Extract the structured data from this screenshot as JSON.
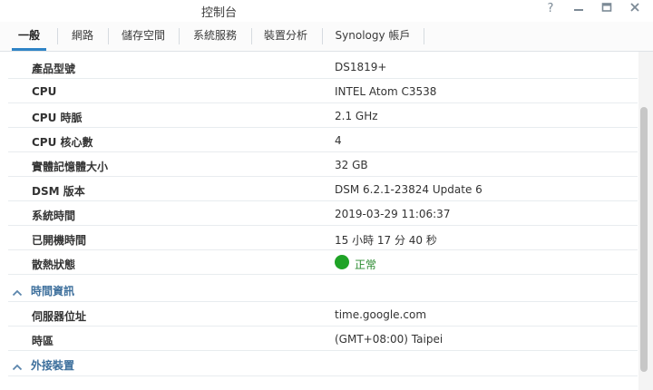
{
  "window": {
    "title": "控制台"
  },
  "tabs": [
    {
      "label": "一般"
    },
    {
      "label": "網路"
    },
    {
      "label": "儲存空間"
    },
    {
      "label": "系統服務"
    },
    {
      "label": "裝置分析"
    },
    {
      "label": "Synology 帳戶"
    }
  ],
  "rows": [
    {
      "label": "產品型號",
      "value": "DS1819+"
    },
    {
      "label": "CPU",
      "value": "INTEL Atom C3538"
    },
    {
      "label": "CPU 時脈",
      "value": "2.1 GHz"
    },
    {
      "label": "CPU 核心數",
      "value": "4"
    },
    {
      "label": "實體記憶體大小",
      "value": "32 GB"
    },
    {
      "label": "DSM 版本",
      "value": "DSM 6.2.1-23824 Update 6"
    },
    {
      "label": "系統時間",
      "value": "2019-03-29 11:06:37"
    },
    {
      "label": "已開機時間",
      "value": "15 小時 17 分 40 秒"
    },
    {
      "label": "散熱狀態",
      "value": "正常"
    }
  ],
  "sections": [
    {
      "title": "時間資訊",
      "rows": [
        {
          "label": "伺服器位址",
          "value": "time.google.com"
        },
        {
          "label": "時區",
          "value": "(GMT+08:00) Taipei"
        }
      ]
    },
    {
      "title": "外接裝置",
      "rows": []
    }
  ],
  "icons": {
    "help": "help-icon",
    "minimize": "minimize-icon",
    "maximize": "maximize-icon",
    "close": "close-icon",
    "section_toggle": "chevron-up-icon",
    "status": "status-dot-icon"
  },
  "colors": {
    "accent": "#2f84c6",
    "section_title": "#3d6f9c",
    "status_ok": "#1fa326"
  }
}
